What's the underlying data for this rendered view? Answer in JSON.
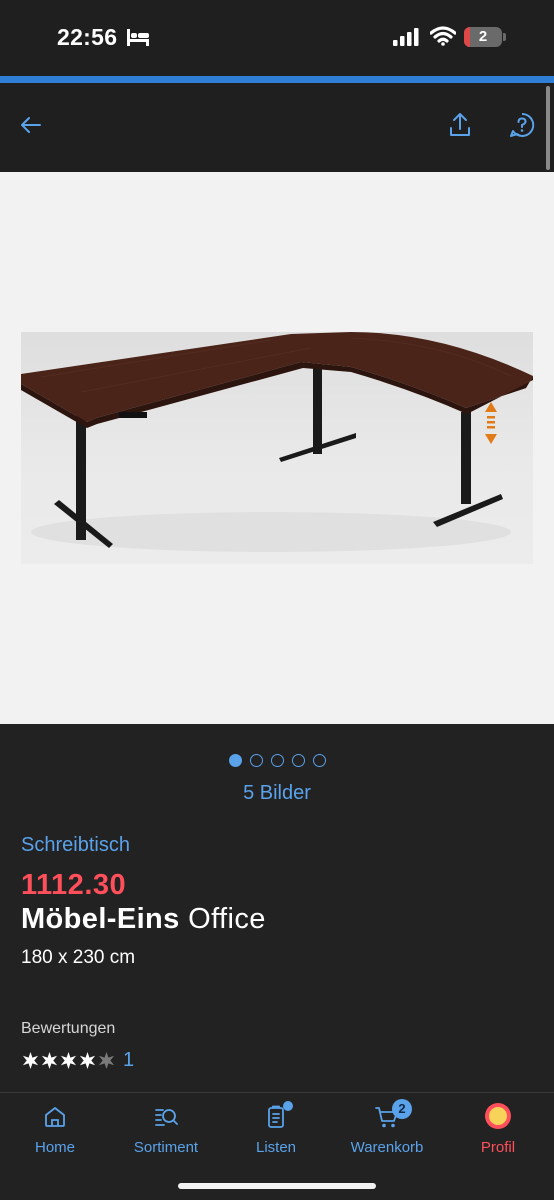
{
  "status_bar": {
    "time": "22:56",
    "battery_level": "2",
    "icons": [
      "bed-icon",
      "cellular-signal-icon",
      "wifi-icon",
      "battery-icon"
    ]
  },
  "header": {
    "back_icon": "arrow-left-icon",
    "share_icon": "share-icon",
    "help_icon": "help-bubble-icon"
  },
  "gallery": {
    "image_description_icon": "product-image",
    "pages": 5,
    "active_page": 1,
    "count_label": "5 Bilder"
  },
  "product": {
    "category": "Schreibtisch",
    "price": "1112.30",
    "brand": "Möbel-Eins",
    "model": "Office",
    "dimensions": "180 x 230 cm"
  },
  "ratings": {
    "label": "Bewertungen",
    "stars_filled": 4,
    "stars_total": 5,
    "count": "1"
  },
  "tab_bar": {
    "tabs": [
      {
        "label": "Home",
        "icon": "home-icon"
      },
      {
        "label": "Sortiment",
        "icon": "catalog-search-icon"
      },
      {
        "label": "Listen",
        "icon": "list-document-icon"
      },
      {
        "label": "Warenkorb",
        "icon": "cart-icon",
        "badge": "2"
      },
      {
        "label": "Profil",
        "icon": "profile-avatar-icon",
        "active": true
      }
    ]
  },
  "colors": {
    "accent": "#5aa2ea",
    "price": "#ff4f5a",
    "background": "#222222",
    "header": "#1f1f1f",
    "gallery_bg": "#f2f2f2"
  }
}
